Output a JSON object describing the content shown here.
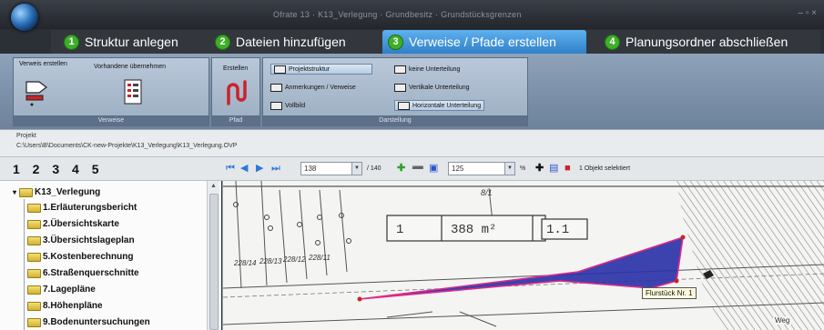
{
  "window": {
    "title": "Ofrate 13 · K13_Verlegung · Grundbesitz · Grundstücksgrenzen",
    "controls": "– ▫ ×"
  },
  "steps": [
    {
      "num": "1",
      "label": "Struktur anlegen",
      "active": false
    },
    {
      "num": "2",
      "label": "Dateien hinzufügen",
      "active": false
    },
    {
      "num": "3",
      "label": "Verweise / Pfade erstellen",
      "active": true
    },
    {
      "num": "4",
      "label": "Planungsordner abschließen",
      "active": false
    }
  ],
  "ribbon": {
    "verweise": {
      "caption": "Verweise",
      "create_label": "Verweis erstellen",
      "take_label": "Vorhandene übernehmen"
    },
    "pfad": {
      "caption": "Pfad",
      "create_label": "Erstellen"
    },
    "darstellung": {
      "caption": "Darstellung",
      "projektstruktur": "Projektstruktur",
      "anmerkungen": "Anmerkungen / Verweise",
      "vollbild": "Vollbild",
      "keine": "keine Unterteilung",
      "vertikal": "Vertikale Unterteilung",
      "horizontal": "Horizontale Unterteilung"
    }
  },
  "project": {
    "label": "Projekt",
    "path": "C:\\Users\\B\\Documents\\CK-new-Projekte\\K13_Verlegung\\K13_Verlegung.OVP"
  },
  "levels": "1 2 3 4 5",
  "toolbar": {
    "page_value": "138",
    "page_total": "/ 140",
    "zoom_value": "125",
    "zoom_unit": "%",
    "status": "1 Objekt selektiert"
  },
  "tree": {
    "root": "K13_Verlegung",
    "items": [
      "1.Erläuterungsbericht",
      "2.Übersichtskarte",
      "3.Übersichtslageplan",
      "5.Kostenberechnung",
      "6.Straßenquerschnitte",
      "7.Lagepläne",
      "8.Höhenpläne",
      "9.Bodenuntersuchungen"
    ]
  },
  "drawing": {
    "parcel_number": "1",
    "area": "388 m²",
    "parcel_ref": "1.1",
    "tooltip": "Flurstück Nr. 1",
    "parcel_labels": [
      "228/14",
      "228/13",
      "228/12",
      "228/11"
    ],
    "fraction_top": "8/1",
    "corner_label": "Weg"
  },
  "colors": {
    "active_step": "#4a9de0",
    "step_number": "#3fae2a",
    "selection_fill": "#2b33a8",
    "selection_outline": "#e0288a"
  }
}
